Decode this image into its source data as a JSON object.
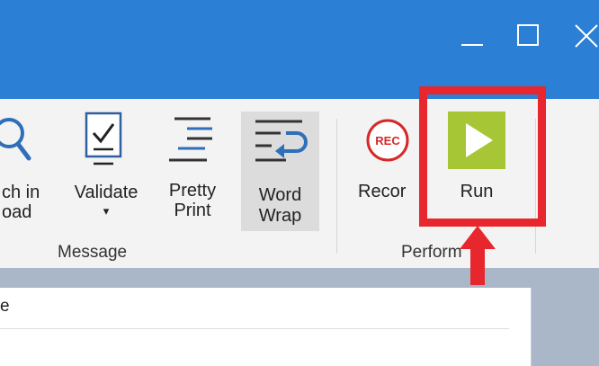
{
  "colors": {
    "titlebar": "#2b7fd4",
    "highlight": "#e8262d",
    "run": "#a7c636",
    "record": "#d62828"
  },
  "window_controls": {
    "minimize_icon": "minimize-icon",
    "maximize_icon": "maximize-icon",
    "close_icon": "close-icon"
  },
  "ribbon": {
    "buttons": {
      "search_label1": "ch in",
      "search_label2": "oad",
      "validate_label": "Validate",
      "validate_caret": "▾",
      "pretty_label1": "Pretty",
      "pretty_label2": "Print",
      "wordwrap_label1": "Word",
      "wordwrap_label2": "Wrap",
      "record_label": "Recor",
      "record_badge": "REC",
      "run_label": "Run"
    },
    "groups": {
      "message": "Message",
      "perform": "Perform"
    }
  },
  "panel": {
    "label": "e"
  }
}
